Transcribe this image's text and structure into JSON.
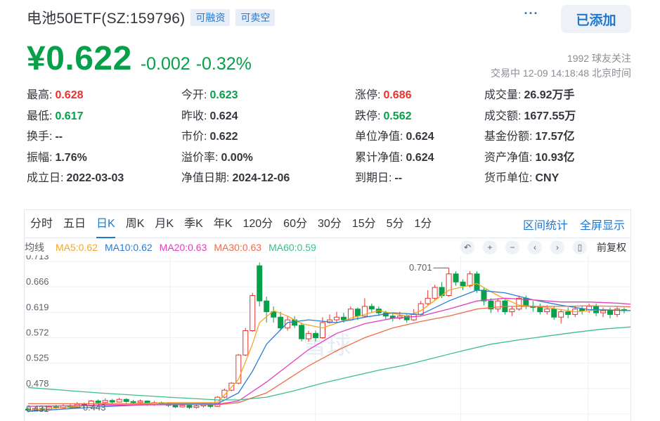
{
  "header": {
    "title": "电池50ETF(SZ:159796)",
    "tags": [
      "可融资",
      "可卖空"
    ],
    "add_button": "已添加",
    "more_icon": "more-icon"
  },
  "price": {
    "current": "¥0.622",
    "change": "-0.002",
    "change_pct": "-0.32%"
  },
  "meta": {
    "followers": "1992 球友关注",
    "status": "交易中 12-09 14:18:48 北京时间"
  },
  "quote": [
    [
      {
        "label": "最高:",
        "value": "0.628",
        "color": "red"
      },
      {
        "label": "今开:",
        "value": "0.623",
        "color": "green"
      },
      {
        "label": "涨停:",
        "value": "0.686",
        "color": "red"
      },
      {
        "label": "成交量:",
        "value": "26.92万手",
        "color": ""
      }
    ],
    [
      {
        "label": "最低:",
        "value": "0.617",
        "color": "green"
      },
      {
        "label": "昨收:",
        "value": "0.624",
        "color": ""
      },
      {
        "label": "跌停:",
        "value": "0.562",
        "color": "green"
      },
      {
        "label": "成交额:",
        "value": "1677.55万",
        "color": ""
      }
    ],
    [
      {
        "label": "换手:",
        "value": "--",
        "color": ""
      },
      {
        "label": "市价:",
        "value": "0.622",
        "color": ""
      },
      {
        "label": "单位净值:",
        "value": "0.624",
        "color": ""
      },
      {
        "label": "基金份额:",
        "value": "17.57亿",
        "color": ""
      }
    ],
    [
      {
        "label": "振幅:",
        "value": "1.76%",
        "color": ""
      },
      {
        "label": "溢价率:",
        "value": "0.00%",
        "color": ""
      },
      {
        "label": "累计净值:",
        "value": "0.624",
        "color": ""
      },
      {
        "label": "资产净值:",
        "value": "10.93亿",
        "color": ""
      }
    ],
    [
      {
        "label": "成立日:",
        "value": "2022-03-03",
        "color": ""
      },
      {
        "label": "净值日期:",
        "value": "2024-12-06",
        "color": ""
      },
      {
        "label": "到期日:",
        "value": "--",
        "color": ""
      },
      {
        "label": "货币单位:",
        "value": "CNY",
        "color": ""
      }
    ]
  ],
  "chart": {
    "periods": [
      "分时",
      "五日",
      "日K",
      "周K",
      "月K",
      "季K",
      "年K",
      "120分",
      "60分",
      "30分",
      "15分",
      "5分",
      "1分"
    ],
    "active_period": "日K",
    "right_links": [
      "区间统计",
      "全屏显示"
    ],
    "ma_label": "均线",
    "ma": [
      {
        "name": "MA5:0.62",
        "color": "#f5a623"
      },
      {
        "name": "MA10:0.62",
        "color": "#2a7bd4"
      },
      {
        "name": "MA20:0.63",
        "color": "#e040c0"
      },
      {
        "name": "MA30:0.63",
        "color": "#f06d4a"
      },
      {
        "name": "MA60:0.59",
        "color": "#3cc08a"
      }
    ],
    "tools": [
      "back-icon",
      "zoom-in-icon",
      "zoom-out-icon",
      "pan-left-icon",
      "pan-right-icon",
      "candle-toggle-icon"
    ],
    "adjust_label": "前复权",
    "watermark": "雪球",
    "colors": {
      "up": "#e8322d",
      "down": "#06a04a",
      "grid": "#eef0f3"
    }
  },
  "chart_data": {
    "type": "candlestick",
    "y_ticks": [
      "0.713",
      "0.666",
      "0.619",
      "0.572",
      "0.525",
      "0.478",
      "0.431"
    ],
    "ylim": [
      0.431,
      0.713
    ],
    "annotations": [
      {
        "text": "0.701",
        "value": 0.701
      },
      {
        "text": "0.443",
        "value": 0.443
      }
    ],
    "candles": [
      [
        0.44,
        0.438,
        0.444,
        0.434
      ],
      [
        0.438,
        0.441,
        0.445,
        0.435
      ],
      [
        0.441,
        0.439,
        0.444,
        0.436
      ],
      [
        0.439,
        0.444,
        0.447,
        0.437
      ],
      [
        0.444,
        0.442,
        0.448,
        0.44
      ],
      [
        0.442,
        0.446,
        0.45,
        0.441
      ],
      [
        0.446,
        0.443,
        0.449,
        0.441
      ],
      [
        0.443,
        0.449,
        0.453,
        0.442
      ],
      [
        0.449,
        0.446,
        0.452,
        0.443
      ],
      [
        0.446,
        0.455,
        0.457,
        0.445
      ],
      [
        0.455,
        0.452,
        0.458,
        0.449
      ],
      [
        0.452,
        0.456,
        0.46,
        0.45
      ],
      [
        0.456,
        0.453,
        0.459,
        0.45
      ],
      [
        0.453,
        0.458,
        0.461,
        0.452
      ],
      [
        0.458,
        0.454,
        0.46,
        0.451
      ],
      [
        0.454,
        0.452,
        0.457,
        0.449
      ],
      [
        0.452,
        0.455,
        0.458,
        0.45
      ],
      [
        0.455,
        0.448,
        0.456,
        0.446
      ],
      [
        0.448,
        0.452,
        0.455,
        0.446
      ],
      [
        0.452,
        0.45,
        0.454,
        0.447
      ],
      [
        0.45,
        0.447,
        0.452,
        0.444
      ],
      [
        0.447,
        0.444,
        0.449,
        0.442
      ],
      [
        0.444,
        0.447,
        0.45,
        0.443
      ],
      [
        0.447,
        0.443,
        0.449,
        0.44
      ],
      [
        0.443,
        0.446,
        0.449,
        0.441
      ],
      [
        0.446,
        0.448,
        0.452,
        0.443
      ],
      [
        0.448,
        0.445,
        0.451,
        0.442
      ],
      [
        0.445,
        0.462,
        0.464,
        0.444
      ],
      [
        0.462,
        0.475,
        0.478,
        0.46
      ],
      [
        0.475,
        0.488,
        0.49,
        0.473
      ],
      [
        0.488,
        0.54,
        0.542,
        0.486
      ],
      [
        0.54,
        0.585,
        0.59,
        0.538
      ],
      [
        0.585,
        0.65,
        0.655,
        0.583
      ],
      [
        0.705,
        0.64,
        0.711,
        0.63
      ],
      [
        0.64,
        0.62,
        0.648,
        0.6
      ],
      [
        0.62,
        0.61,
        0.63,
        0.6
      ],
      [
        0.61,
        0.59,
        0.62,
        0.585
      ],
      [
        0.59,
        0.605,
        0.612,
        0.585
      ],
      [
        0.605,
        0.595,
        0.612,
        0.59
      ],
      [
        0.595,
        0.57,
        0.6,
        0.565
      ],
      [
        0.57,
        0.58,
        0.585,
        0.565
      ],
      [
        0.58,
        0.572,
        0.585,
        0.565
      ],
      [
        0.572,
        0.6,
        0.61,
        0.57
      ],
      [
        0.6,
        0.605,
        0.615,
        0.598
      ],
      [
        0.605,
        0.61,
        0.62,
        0.6
      ],
      [
        0.61,
        0.605,
        0.618,
        0.6
      ],
      [
        0.605,
        0.625,
        0.63,
        0.603
      ],
      [
        0.625,
        0.612,
        0.628,
        0.605
      ],
      [
        0.612,
        0.63,
        0.645,
        0.61
      ],
      [
        0.63,
        0.625,
        0.635,
        0.618
      ],
      [
        0.625,
        0.618,
        0.63,
        0.612
      ],
      [
        0.618,
        0.612,
        0.622,
        0.605
      ],
      [
        0.612,
        0.608,
        0.618,
        0.602
      ],
      [
        0.608,
        0.612,
        0.62,
        0.605
      ],
      [
        0.612,
        0.605,
        0.616,
        0.6
      ],
      [
        0.605,
        0.615,
        0.625,
        0.603
      ],
      [
        0.615,
        0.635,
        0.64,
        0.612
      ],
      [
        0.635,
        0.645,
        0.66,
        0.632
      ],
      [
        0.645,
        0.665,
        0.67,
        0.64
      ],
      [
        0.665,
        0.65,
        0.675,
        0.645
      ],
      [
        0.65,
        0.69,
        0.701,
        0.648
      ],
      [
        0.69,
        0.675,
        0.695,
        0.668
      ],
      [
        0.675,
        0.668,
        0.68,
        0.66
      ],
      [
        0.668,
        0.69,
        0.695,
        0.665
      ],
      [
        0.69,
        0.66,
        0.695,
        0.655
      ],
      [
        0.66,
        0.64,
        0.665,
        0.632
      ],
      [
        0.64,
        0.625,
        0.645,
        0.618
      ],
      [
        0.625,
        0.64,
        0.645,
        0.62
      ],
      [
        0.64,
        0.62,
        0.645,
        0.615
      ],
      [
        0.62,
        0.625,
        0.63,
        0.612
      ],
      [
        0.625,
        0.645,
        0.65,
        0.622
      ],
      [
        0.645,
        0.63,
        0.65,
        0.625
      ],
      [
        0.63,
        0.628,
        0.64,
        0.62
      ],
      [
        0.628,
        0.62,
        0.635,
        0.615
      ],
      [
        0.62,
        0.625,
        0.632,
        0.615
      ],
      [
        0.625,
        0.61,
        0.63,
        0.605
      ],
      [
        0.61,
        0.62,
        0.625,
        0.598
      ],
      [
        0.62,
        0.615,
        0.628,
        0.608
      ],
      [
        0.615,
        0.625,
        0.63,
        0.61
      ],
      [
        0.625,
        0.622,
        0.632,
        0.615
      ],
      [
        0.622,
        0.63,
        0.635,
        0.618
      ],
      [
        0.63,
        0.618,
        0.635,
        0.612
      ],
      [
        0.618,
        0.622,
        0.628,
        0.61
      ],
      [
        0.622,
        0.615,
        0.628,
        0.608
      ],
      [
        0.615,
        0.625,
        0.63,
        0.61
      ],
      [
        0.624,
        0.622,
        0.628,
        0.617
      ]
    ],
    "ma_series": [
      {
        "name": "MA5",
        "color": "#f5a623",
        "points": [
          [
            0,
            0.438
          ],
          [
            10,
            0.448
          ],
          [
            20,
            0.452
          ],
          [
            27,
            0.452
          ],
          [
            30,
            0.495
          ],
          [
            32,
            0.56
          ],
          [
            33,
            0.6
          ],
          [
            35,
            0.622
          ],
          [
            37,
            0.612
          ],
          [
            39,
            0.598
          ],
          [
            42,
            0.59
          ],
          [
            46,
            0.608
          ],
          [
            50,
            0.622
          ],
          [
            54,
            0.612
          ],
          [
            56,
            0.622
          ],
          [
            60,
            0.66
          ],
          [
            64,
            0.672
          ],
          [
            67,
            0.65
          ],
          [
            70,
            0.632
          ],
          [
            74,
            0.628
          ],
          [
            78,
            0.62
          ],
          [
            82,
            0.624
          ],
          [
            86,
            0.622
          ]
        ]
      },
      {
        "name": "MA10",
        "color": "#2a7bd4",
        "points": [
          [
            0,
            0.436
          ],
          [
            10,
            0.444
          ],
          [
            20,
            0.45
          ],
          [
            27,
            0.45
          ],
          [
            30,
            0.47
          ],
          [
            32,
            0.51
          ],
          [
            34,
            0.56
          ],
          [
            37,
            0.6
          ],
          [
            40,
            0.605
          ],
          [
            44,
            0.6
          ],
          [
            48,
            0.61
          ],
          [
            52,
            0.618
          ],
          [
            56,
            0.615
          ],
          [
            60,
            0.64
          ],
          [
            64,
            0.66
          ],
          [
            68,
            0.655
          ],
          [
            72,
            0.642
          ],
          [
            76,
            0.632
          ],
          [
            80,
            0.624
          ],
          [
            86,
            0.622
          ]
        ]
      },
      {
        "name": "MA20",
        "color": "#e040c0",
        "points": [
          [
            0,
            0.445
          ],
          [
            10,
            0.447
          ],
          [
            20,
            0.448
          ],
          [
            27,
            0.449
          ],
          [
            30,
            0.455
          ],
          [
            34,
            0.49
          ],
          [
            37,
            0.52
          ],
          [
            40,
            0.55
          ],
          [
            44,
            0.58
          ],
          [
            48,
            0.598
          ],
          [
            52,
            0.608
          ],
          [
            56,
            0.612
          ],
          [
            60,
            0.625
          ],
          [
            64,
            0.64
          ],
          [
            68,
            0.645
          ],
          [
            72,
            0.642
          ],
          [
            76,
            0.638
          ],
          [
            80,
            0.638
          ],
          [
            84,
            0.636
          ],
          [
            86,
            0.634
          ]
        ]
      },
      {
        "name": "MA30",
        "color": "#f06d4a",
        "points": [
          [
            0,
            0.45
          ],
          [
            10,
            0.45
          ],
          [
            20,
            0.449
          ],
          [
            27,
            0.448
          ],
          [
            30,
            0.452
          ],
          [
            34,
            0.47
          ],
          [
            37,
            0.495
          ],
          [
            40,
            0.52
          ],
          [
            44,
            0.548
          ],
          [
            48,
            0.572
          ],
          [
            52,
            0.59
          ],
          [
            56,
            0.602
          ],
          [
            60,
            0.612
          ],
          [
            64,
            0.625
          ],
          [
            68,
            0.63
          ],
          [
            72,
            0.63
          ],
          [
            76,
            0.63
          ],
          [
            80,
            0.631
          ],
          [
            84,
            0.63
          ],
          [
            86,
            0.629
          ]
        ]
      },
      {
        "name": "MA60",
        "color": "#3cc08a",
        "points": [
          [
            0,
            0.48
          ],
          [
            10,
            0.47
          ],
          [
            20,
            0.462
          ],
          [
            27,
            0.457
          ],
          [
            30,
            0.457
          ],
          [
            34,
            0.462
          ],
          [
            38,
            0.474
          ],
          [
            42,
            0.488
          ],
          [
            46,
            0.5
          ],
          [
            50,
            0.512
          ],
          [
            54,
            0.522
          ],
          [
            58,
            0.535
          ],
          [
            62,
            0.548
          ],
          [
            66,
            0.56
          ],
          [
            70,
            0.568
          ],
          [
            74,
            0.575
          ],
          [
            78,
            0.582
          ],
          [
            82,
            0.588
          ],
          [
            86,
            0.592
          ]
        ]
      }
    ]
  }
}
